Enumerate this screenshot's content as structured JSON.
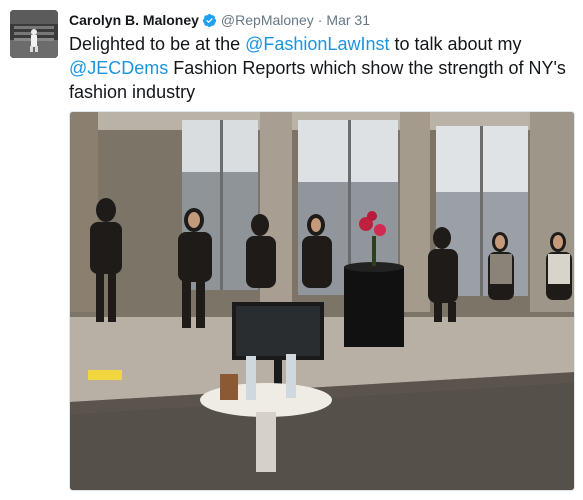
{
  "tweet": {
    "author_name": "Carolyn B. Maloney",
    "handle": "@RepMaloney",
    "separator": "·",
    "timestamp": "Mar 31",
    "text_parts": [
      "Delighted to be at the ",
      "@FashionLawInst",
      " to talk about my ",
      "@JECDems",
      " Fashion Reports which show the strength of NY's fashion industry"
    ],
    "verified_icon": "verified-badge-icon",
    "colors": {
      "link": "#1b95e0",
      "secondary_text": "#657786",
      "verified": "#1da1f2"
    }
  }
}
